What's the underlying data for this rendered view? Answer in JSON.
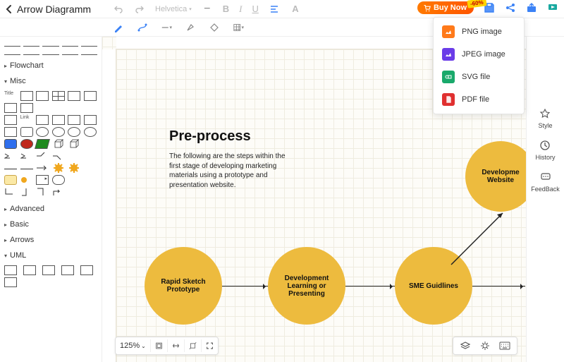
{
  "header": {
    "title": "Arrow Diagramm",
    "font": "Helvetica",
    "buy_label": "Buy Now",
    "buy_badge": "-60%"
  },
  "sidebar": {
    "categories": {
      "flowchart": "Flowchart",
      "misc": "Misc",
      "advanced": "Advanced",
      "basic": "Basic",
      "arrows": "Arrows",
      "uml": "UML"
    },
    "labels": {
      "title": "Title",
      "link": "Link"
    }
  },
  "canvas": {
    "heading": "Pre-process",
    "description": "The following are the steps within the first stage of developing marketing materials using a prototype and presentation website.",
    "nodes": [
      {
        "id": "n1",
        "label": "Rapid Sketch Prototype"
      },
      {
        "id": "n2",
        "label": "Development Learning or Presenting"
      },
      {
        "id": "n3",
        "label": "SME Guidlines"
      },
      {
        "id": "n4",
        "label": "Developme Website"
      }
    ],
    "zoom": "125%"
  },
  "export_menu": {
    "items": [
      {
        "type": "png",
        "label": "PNG image"
      },
      {
        "type": "jpeg",
        "label": "JPEG image"
      },
      {
        "type": "svg",
        "label": "SVG file"
      },
      {
        "type": "pdf",
        "label": "PDF file"
      }
    ]
  },
  "rightrail": {
    "style": "Style",
    "history": "History",
    "feedback": "FeedBack"
  },
  "colors": {
    "accent": "#edbb3e",
    "primary": "#3b82f6",
    "buy": "#ff6a00"
  }
}
